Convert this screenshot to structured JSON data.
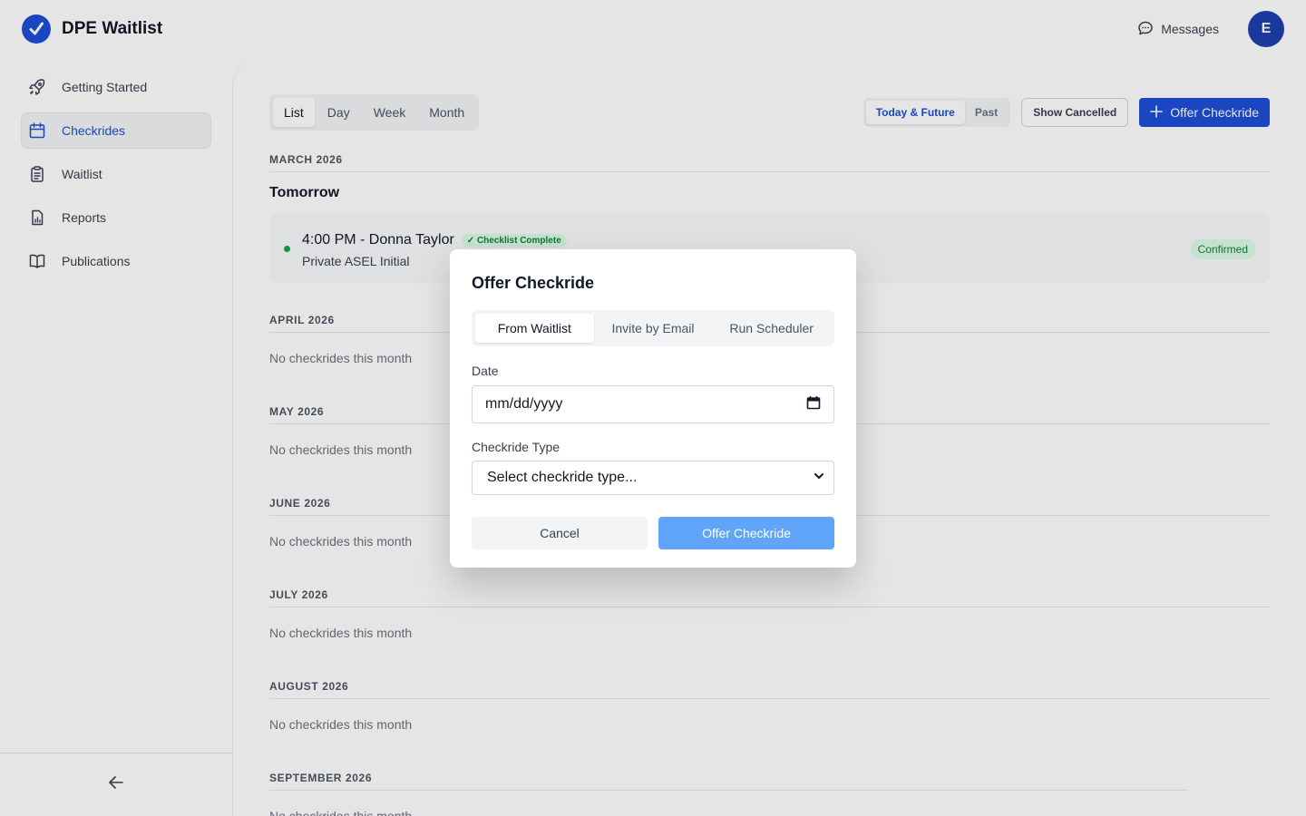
{
  "app": {
    "title": "DPE Waitlist",
    "messages_label": "Messages",
    "avatar_initial": "E"
  },
  "sidebar": {
    "items": [
      {
        "label": "Getting Started",
        "icon": "rocket-icon"
      },
      {
        "label": "Checkrides",
        "icon": "calendar-icon",
        "active": true
      },
      {
        "label": "Waitlist",
        "icon": "clipboard-icon"
      },
      {
        "label": "Reports",
        "icon": "report-icon"
      },
      {
        "label": "Publications",
        "icon": "book-icon"
      }
    ],
    "collapse_icon": "arrow-left-icon"
  },
  "toolbar": {
    "views": [
      "List",
      "Day",
      "Week",
      "Month"
    ],
    "active_view": "List",
    "range_filters": [
      "Today & Future",
      "Past"
    ],
    "active_range": "Today & Future",
    "show_cancelled_label": "Show Cancelled",
    "offer_button_label": "Offer Checkride"
  },
  "schedule": {
    "months": [
      {
        "label": "MARCH 2026"
      },
      {
        "label": "APRIL 2026",
        "empty": "No checkrides this month"
      },
      {
        "label": "MAY 2026",
        "empty": "No checkrides this month"
      },
      {
        "label": "JUNE 2026",
        "empty": "No checkrides this month"
      },
      {
        "label": "JULY 2026",
        "empty": "No checkrides this month"
      },
      {
        "label": "AUGUST 2026",
        "empty": "No checkrides this month"
      },
      {
        "label": "SEPTEMBER 2026",
        "empty": "No checkrides this month"
      }
    ],
    "day_heading": "Tomorrow",
    "event": {
      "title": "4:00 PM - Donna Taylor",
      "badge": "✓ Checklist Complete",
      "subtitle": "Private ASEL Initial",
      "status": "Confirmed"
    }
  },
  "modal": {
    "title": "Offer Checkride",
    "tabs": [
      "From Waitlist",
      "Invite by Email",
      "Run Scheduler"
    ],
    "active_tab": "From Waitlist",
    "date_label": "Date",
    "date_placeholder": "mm/dd/yyyy",
    "type_label": "Checkride Type",
    "type_placeholder": "Select checkride type...",
    "cancel_label": "Cancel",
    "submit_label": "Offer Checkride"
  },
  "colors": {
    "accent": "#1d4ed8",
    "submit_disabled": "#60a5fa",
    "success": "#16a34a"
  }
}
